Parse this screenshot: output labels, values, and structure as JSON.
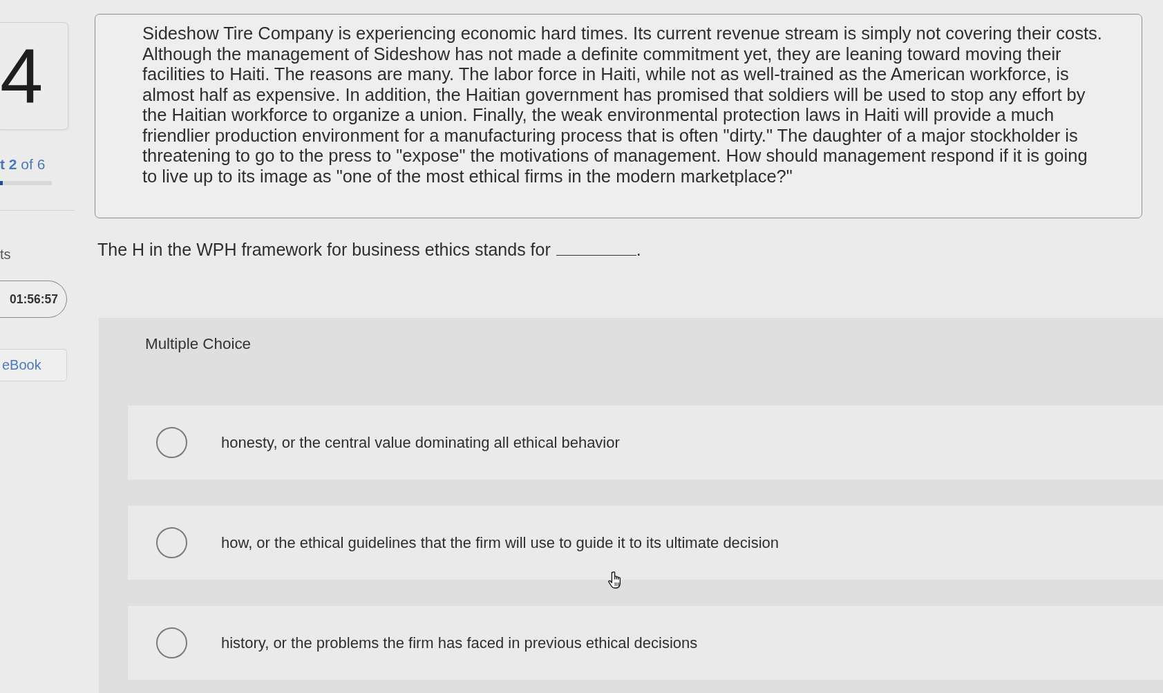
{
  "sidebar": {
    "question_number": "4",
    "part_label": "**t 2** of 6",
    "progress": {
      "level": 0.05
    },
    "points_label": "ts",
    "timer": "01:56:57",
    "ebook_button": "eBook"
  },
  "passage": "Sideshow Tire Company is experiencing economic hard times. Its current revenue stream is simply not covering their costs. Although the management of Sideshow has not made a definite commitment yet, they are leaning toward moving their facilities to Haiti. The reasons are many. The labor force in Haiti, while not as well-trained as the American workforce, is almost half as expensive. In addition, the Haitian government has promised that soldiers will be used to stop any effort by the Haitian workforce to organize a union. Finally, the weak environmental protection laws in Haiti will provide a much friendlier production environment for a manufacturing process that is often \"dirty.\" The daughter of a major stockholder is threatening to go to the press to \"expose\" the motivations of management. How should management respond if it is going to live up to its image as \"one of the most ethical firms in the modern marketplace?\"",
  "question": {
    "text": "The H in the WPH framework for business ethics stands for",
    "after_blank": "."
  },
  "multiple_choice": {
    "heading": "Multiple Choice",
    "options": [
      {
        "text": "honesty, or the central value dominating all ethical behavior",
        "selected": false
      },
      {
        "text": "how, or the ethical guidelines that the firm will use to guide it to its ultimate decision",
        "selected": false
      },
      {
        "text": "history, or the problems the firm has faced in previous ethical decisions",
        "selected": false
      }
    ]
  }
}
